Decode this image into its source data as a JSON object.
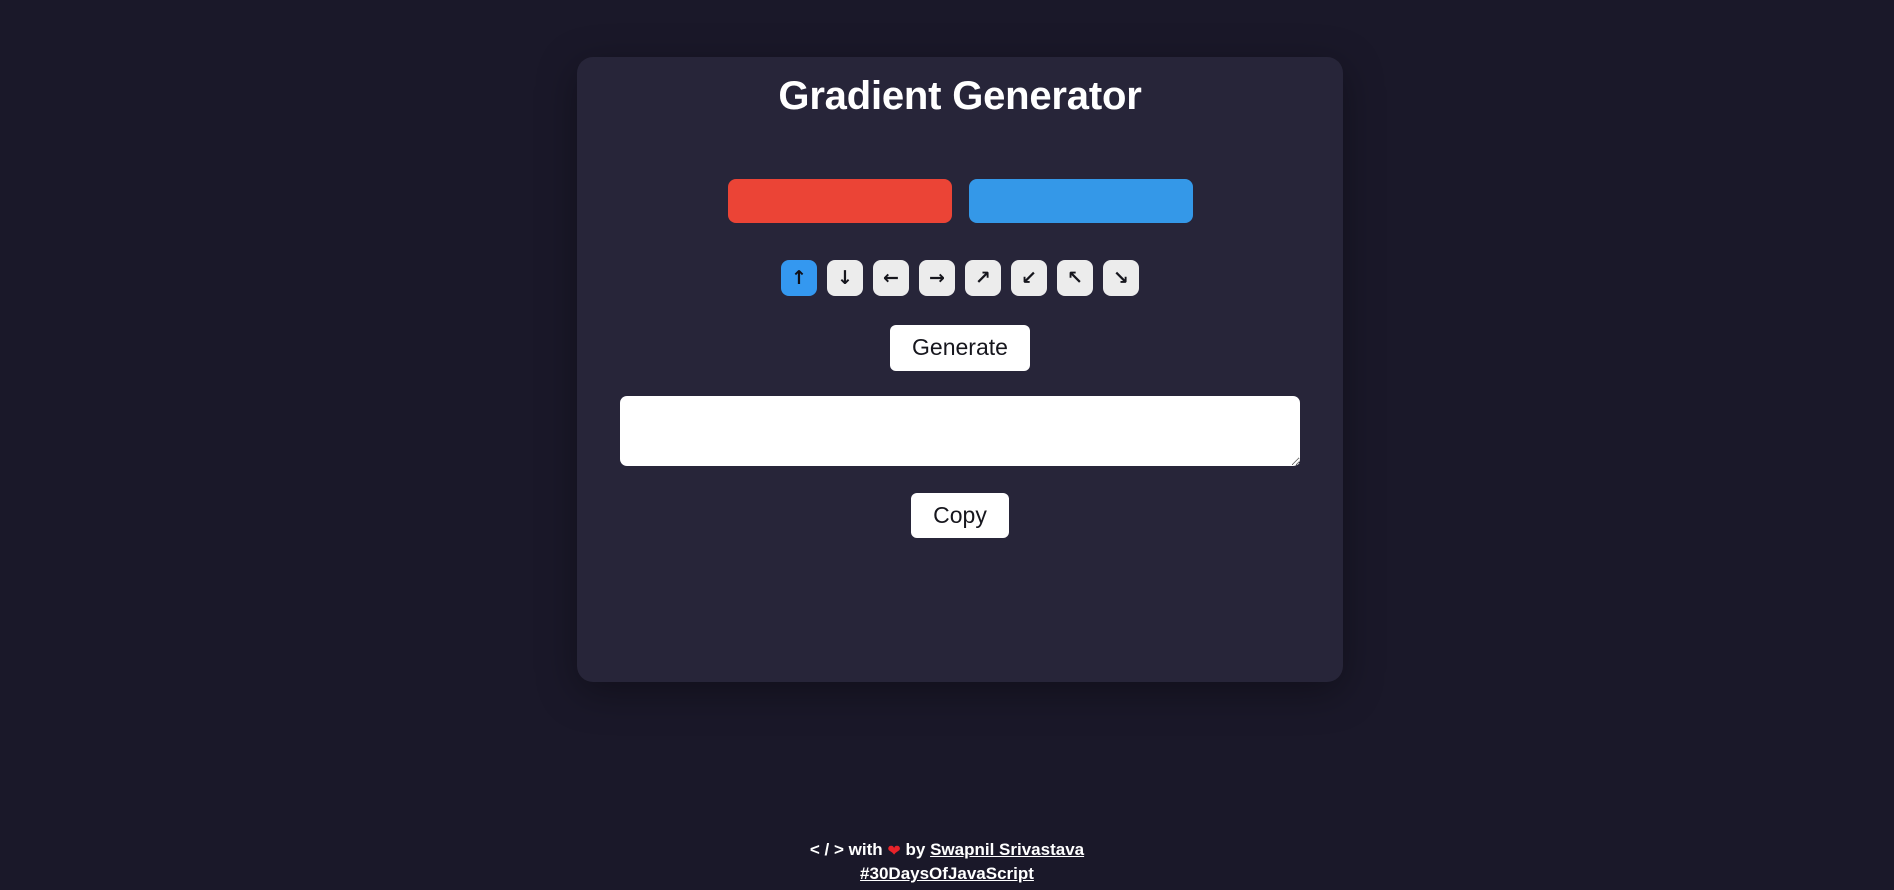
{
  "page": {
    "background_color": "#1a1829",
    "card_background_color": "#272539"
  },
  "card": {
    "title": "Gradient Generator"
  },
  "colors": {
    "label_color_one": "color-swatch-one",
    "label_color_two": "color-swatch-two",
    "color_one": "#eb4436",
    "color_two": "#3498e8"
  },
  "directions": {
    "selected_index": 0,
    "active_color": "#3498f0",
    "inactive_color": "#ececec",
    "items": [
      {
        "name": "direction-up",
        "glyph": "↑",
        "title": "to top"
      },
      {
        "name": "direction-down",
        "glyph": "↓",
        "title": "to bottom"
      },
      {
        "name": "direction-left",
        "glyph": "←",
        "title": "to left"
      },
      {
        "name": "direction-right",
        "glyph": "→",
        "title": "to right"
      },
      {
        "name": "direction-up-right",
        "glyph": "↗",
        "title": "to top right"
      },
      {
        "name": "direction-down-left",
        "glyph": "↙",
        "title": "to bottom left"
      },
      {
        "name": "direction-up-left",
        "glyph": "↖",
        "title": "to top left"
      },
      {
        "name": "direction-down-right",
        "glyph": "↘",
        "title": "to bottom right"
      }
    ]
  },
  "actions": {
    "generate_label": "Generate",
    "copy_label": "Copy"
  },
  "output": {
    "value": "",
    "placeholder": ""
  },
  "footer": {
    "prefix": "< / > with",
    "heart": "❤",
    "by": "by",
    "author": "Swapnil Srivastava",
    "hashtag": "#30DaysOfJavaScript"
  }
}
